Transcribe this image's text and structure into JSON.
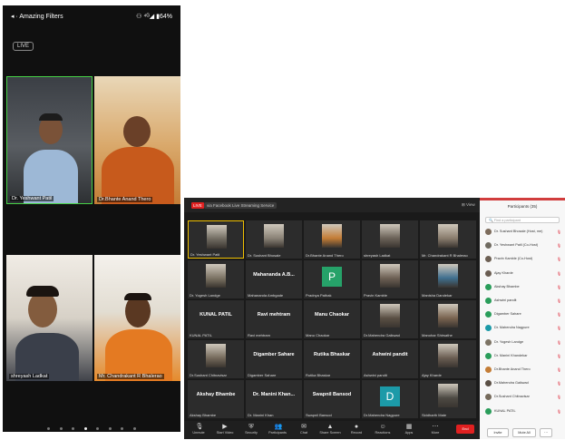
{
  "phone": {
    "status_left": "◂ · Amazing Filters",
    "status_right": "⚇ ⁴ᴳ◢ ▮64%",
    "live_badge": "LIVE",
    "tiles": [
      {
        "name": "Dr. Yeshwant Patil"
      },
      {
        "name": "Dr.Bhante Anand Thero"
      },
      {
        "name": "shreyash Ladkat"
      },
      {
        "name": "Mr. Chandrakant R Bhalerao"
      }
    ]
  },
  "zoom": {
    "live": "LIVE",
    "title": "via Facebook Live Streaming Service",
    "view_label": "⊞ View",
    "grid": [
      {
        "label": "Dr. Yeshwant Patil",
        "kind": "video",
        "color": "#6f6a60"
      },
      {
        "label": "Dr. Sushant Bhosale",
        "kind": "video",
        "color": "#8b8377"
      },
      {
        "label": "Dr.Bhante Anand Thero",
        "kind": "video",
        "color": "#c47d36"
      },
      {
        "label": "shreyash Ladkat",
        "kind": "video",
        "color": "#6b6258"
      },
      {
        "label": "Mr. Chandrakant R Bhalerao",
        "kind": "video",
        "color": "#8a7d6e"
      },
      {
        "label": "Dr. Yogesh Landge",
        "kind": "video",
        "color": "#7c7364"
      },
      {
        "label": "Mahananda Ambgade",
        "kind": "text",
        "big": "Mahananda  A.B..."
      },
      {
        "label": "Pradnya Pathak",
        "kind": "avatar",
        "letter": "P",
        "color": "#26a269"
      },
      {
        "label": "Pravin Kamble",
        "kind": "video",
        "color": "#6d6054"
      },
      {
        "label": "Manisha Dandekar",
        "kind": "video",
        "color": "#3f6f8f"
      },
      {
        "label": "KUNAL PATIL",
        "kind": "text",
        "big": "KUNAL PATIL"
      },
      {
        "label": "Ravi mehtram",
        "kind": "text",
        "big": "Ravi mehtram"
      },
      {
        "label": "Manu Chaokar",
        "kind": "text",
        "big": "Manu Chaokar"
      },
      {
        "label": "Dr.Mahendra Gaikwad",
        "kind": "video",
        "color": "#5a4f44"
      },
      {
        "label": "Manohar Shirsathe",
        "kind": "video",
        "color": "#7a6450"
      },
      {
        "label": "Dr.Sushant Chitnavisar",
        "kind": "video",
        "color": "#756a5b"
      },
      {
        "label": "Digamber Sahare",
        "kind": "text",
        "big": "Digamber Sahare"
      },
      {
        "label": "Rutika Bhaskar",
        "kind": "text",
        "big": "Rutika Bhaskar"
      },
      {
        "label": "Ashwini pandit",
        "kind": "text",
        "big": "Ashwini pandit"
      },
      {
        "label": "Ajay Kharde",
        "kind": "video",
        "color": "#6a5d52"
      },
      {
        "label": "Akshay Bhambe",
        "kind": "text",
        "big": "Akshay Bhambe"
      },
      {
        "label": "Dr. Manini Khan",
        "kind": "text",
        "big": "Dr. Manini  Khan..."
      },
      {
        "label": "Swapnil Bansod",
        "kind": "text",
        "big": "Swapnil Bansod"
      },
      {
        "label": "Dr.Mahendra Nagpure",
        "kind": "avatar",
        "letter": "D",
        "color": "#1c9aa8"
      },
      {
        "label": "Siddharth Mate",
        "kind": "video",
        "color": "#4d4a44"
      }
    ],
    "toolbar": [
      {
        "label": "Unmute",
        "icon": "🎙"
      },
      {
        "label": "Start Video",
        "icon": "▶"
      },
      {
        "label": "Security",
        "icon": "⛨"
      },
      {
        "label": "Participants",
        "icon": "👥"
      },
      {
        "label": "Chat",
        "icon": "✉"
      },
      {
        "label": "Share Screen",
        "icon": "▲"
      },
      {
        "label": "Record",
        "icon": "●"
      },
      {
        "label": "Reactions",
        "icon": "☺"
      },
      {
        "label": "Apps",
        "icon": "▦"
      },
      {
        "label": "More",
        "icon": "⋯"
      }
    ],
    "end_label": "End"
  },
  "participants": {
    "title": "Participants (35)",
    "search_placeholder": "🔍 Find a participant",
    "rows": [
      {
        "name": "Dr. Sushant Bhosale (Host, me)",
        "color": "#7d6c5c"
      },
      {
        "name": "Dr. Yeshwant Patil (Co-Host)",
        "color": "#6f6a60"
      },
      {
        "name": "Pravin Kamble (Co-Host)",
        "color": "#6d6054"
      },
      {
        "name": "Ajay Kharde",
        "color": "#6a5d52"
      },
      {
        "name": "Akshay Bhambe",
        "color": "#2a9d5a"
      },
      {
        "name": "Ashwini pandit",
        "color": "#2a9d5a"
      },
      {
        "name": "Digamber Sahare",
        "color": "#2a9d5a"
      },
      {
        "name": "Dr. Mahendra Nagpure",
        "color": "#1c9aa8"
      },
      {
        "name": "Dr. Yogesh Landge",
        "color": "#7c7364"
      },
      {
        "name": "Dr. Manini Khandekar",
        "color": "#2a9d5a"
      },
      {
        "name": "Dr.Bhante Anand Thero",
        "color": "#c47d36"
      },
      {
        "name": "Dr.Mahendra Gaikwad",
        "color": "#5a4f44"
      },
      {
        "name": "Dr.Sushant Chitnavisar",
        "color": "#756a5b"
      },
      {
        "name": "KUNAL PATIL",
        "color": "#2a9d5a"
      }
    ],
    "invite_label": "Invite",
    "mute_all_label": "Mute All",
    "more_label": "⋯"
  }
}
